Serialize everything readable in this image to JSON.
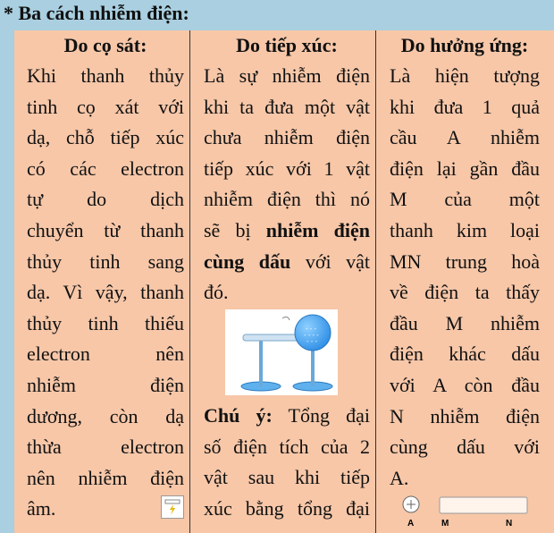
{
  "heading": "* Ba cách nhiễm điện:",
  "columns": [
    {
      "title": "Do cọ sát:",
      "lines": [
        "Khi thanh thủy",
        "tinh cọ xát với",
        "dạ, chỗ tiếp xúc",
        "có các electron",
        "tự do dịch",
        "chuyển từ thanh",
        "thủy tinh sang",
        "dạ. Vì vậy, thanh",
        "thủy tinh thiếu",
        "electron nên",
        "nhiễm điện",
        "dương, còn dạ",
        "thừa electron",
        "nên nhiễm điện",
        "âm."
      ]
    },
    {
      "title": "Do tiếp xúc:",
      "lines": [
        "Là sự nhiễm điện",
        "khi ta đưa một vật",
        "chưa nhiễm điện",
        "tiếp xúc với 1 vật",
        "nhiễm điện thì nó"
      ],
      "line6_pre": "sẽ bị ",
      "line6_bold": "nhiễm điện",
      "line7_bold": "cùng dấu",
      "line7_post": " với vật",
      "line8": "đó.",
      "note_label": "Chú ý:",
      "note_lines": [
        " Tổng đại",
        "số điện tích của 2",
        "vật sau khi tiếp",
        "xúc bằng tổng đại"
      ]
    },
    {
      "title": "Do hưởng ứng:",
      "lines": [
        "Là hiện tượng",
        "khi đưa 1 quả",
        "cầu A nhiễm",
        "điện lại gần đầu",
        "M của một",
        "thanh kim loại",
        "MN trung hoà",
        "về điện ta thấy",
        "đầu M nhiễm",
        "điện khác dấu",
        "với A còn đầu",
        "N nhiễm điện",
        "cùng dấu với",
        "A."
      ],
      "diagram_labels": {
        "a": "A",
        "m": "M",
        "n": "N"
      }
    }
  ],
  "colors": {
    "background": "#a9cfe0",
    "table": "#f7c7a8",
    "sphere": "#2f8fe6"
  }
}
